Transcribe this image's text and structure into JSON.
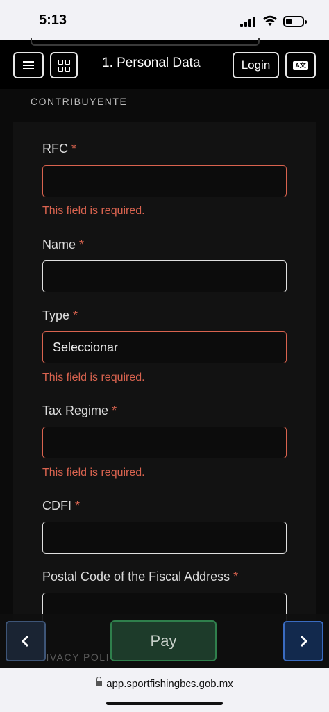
{
  "status": {
    "time": "5:13"
  },
  "header": {
    "title": "1. Personal Data",
    "login_label": "Login",
    "lang_icon_text": "A文"
  },
  "section": {
    "label": "CONTRIBUYENTE"
  },
  "form": {
    "required_mark": "*",
    "error_text": "This field is required.",
    "fields": [
      {
        "label": "RFC",
        "value": ""
      },
      {
        "label": "Name",
        "value": ""
      },
      {
        "label": "Type",
        "value": "Seleccionar"
      },
      {
        "label": "Tax Regime",
        "value": ""
      },
      {
        "label": "CDFI",
        "value": ""
      },
      {
        "label": "Postal Code of the Fiscal Address",
        "value": ""
      }
    ]
  },
  "footer": {
    "privacy_label": "PRIVACY POLICY",
    "pay_label": "Pay",
    "prev_icon": "chevron-left",
    "next_icon": "chevron-right"
  },
  "browser": {
    "domain": "app.sportfishingbcs.gob.mx"
  },
  "colors": {
    "error": "#d9634f",
    "background": "#0b0b0b",
    "pay": "#1d3b2a",
    "next": "#12294d"
  }
}
